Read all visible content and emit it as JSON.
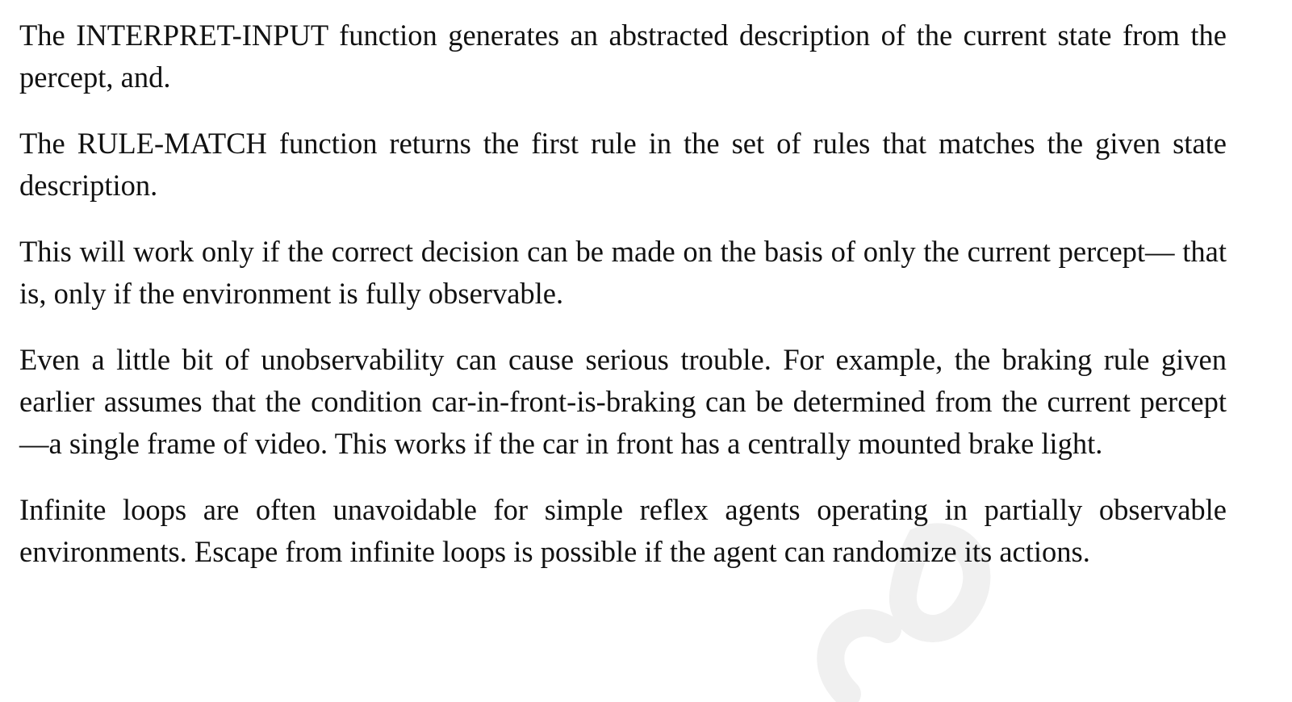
{
  "paragraphs": [
    "The INTERPRET-INPUT function generates an abstracted description of the current state from the percept, and.",
    "The RULE-MATCH function returns the first rule in the set of rules that matches the given state description.",
    "This will work only if the correct decision can be made on the basis of only the current percept— that is, only if the environment is fully observable.",
    "Even a little bit of unobservability can cause serious trouble. For example, the braking rule given earlier assumes that the condition car-in-front-is-braking can be determined from the current percept—a single frame of video. This works if the car in front has a centrally mounted brake light.",
    "Infinite loops are often unavoidable for simple reflex agents operating in partially observable environments. Escape from infinite loops is possible if the agent can randomize its actions."
  ],
  "watermark": {
    "color": "#f0f0f0"
  }
}
